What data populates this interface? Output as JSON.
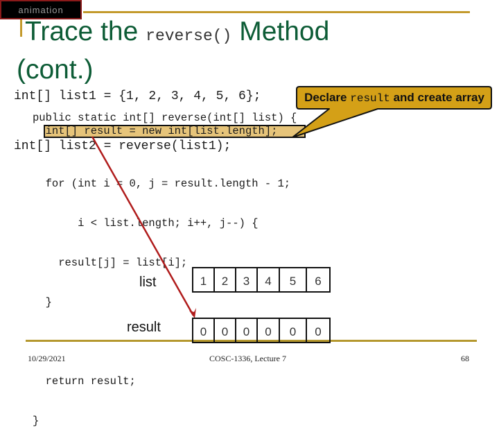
{
  "animation_tag": "animation",
  "title": {
    "prefix": "Trace the ",
    "code": "reverse()",
    "suffix": " Method",
    "continuation": "(cont.)"
  },
  "top_code": [
    "int[] list1 = {1, 2, 3, 4, 5, 6};",
    "int[] list2 = reverse(list1);"
  ],
  "callout": {
    "before": "Declare ",
    "code": "result",
    "after": " and create array",
    "fill_color": "#d4a017"
  },
  "method_code": {
    "signature": "public static int[] reverse(int[] list) {",
    "highlighted_line": "  int[] result = new int[list.length];",
    "body": [
      "  for (int i = 0, j = result.length - 1;",
      "       i < list.length; i++, j--) {",
      "    result[j] = list[i];",
      "  }",
      "",
      "  return result;",
      "}"
    ]
  },
  "arrays": {
    "list": {
      "label": "list",
      "values": [
        "1",
        "2",
        "3",
        "4",
        "5",
        "6"
      ]
    },
    "result": {
      "label": "result",
      "values": [
        "0",
        "0",
        "0",
        "0",
        "0",
        "0"
      ]
    }
  },
  "footer": {
    "date": "10/29/2021",
    "course": "COSC-1336, Lecture 7",
    "page": "68"
  },
  "colors": {
    "title_green": "#0d5c36",
    "accent_gold": "#c39a2c",
    "highlight": "#e6c47a",
    "arrow_red": "#b01c1c"
  }
}
